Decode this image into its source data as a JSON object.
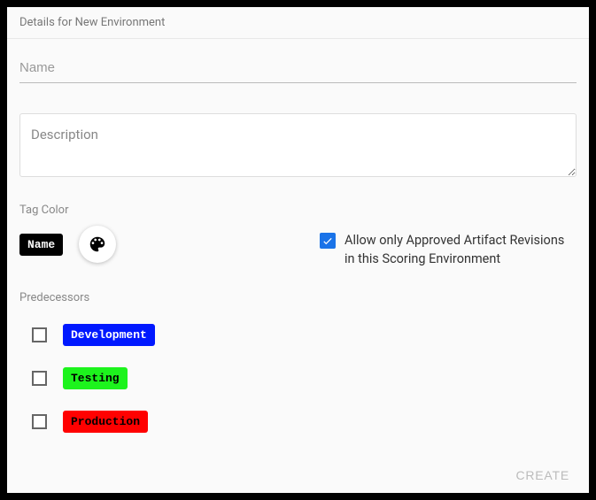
{
  "header": {
    "title": "Details for New Environment"
  },
  "fields": {
    "name_placeholder": "Name",
    "name_value": "",
    "description_placeholder": "Description",
    "description_value": ""
  },
  "tag": {
    "section_label": "Tag Color",
    "preview_text": "Name",
    "preview_bg": "#000000",
    "preview_fg": "#ffffff"
  },
  "approval": {
    "checked": true,
    "label": "Allow only Approved Artifact Revisions in this Scoring Environment"
  },
  "predecessors": {
    "section_label": "Predecessors",
    "items": [
      {
        "label": "Development",
        "bg": "#0018ff",
        "fg": "#ffffff",
        "checked": false
      },
      {
        "label": "Testing",
        "bg": "#1df31d",
        "fg": "#000000",
        "checked": false
      },
      {
        "label": "Production",
        "bg": "#ff0000",
        "fg": "#000000",
        "checked": false
      }
    ]
  },
  "footer": {
    "create_label": "CREATE"
  }
}
